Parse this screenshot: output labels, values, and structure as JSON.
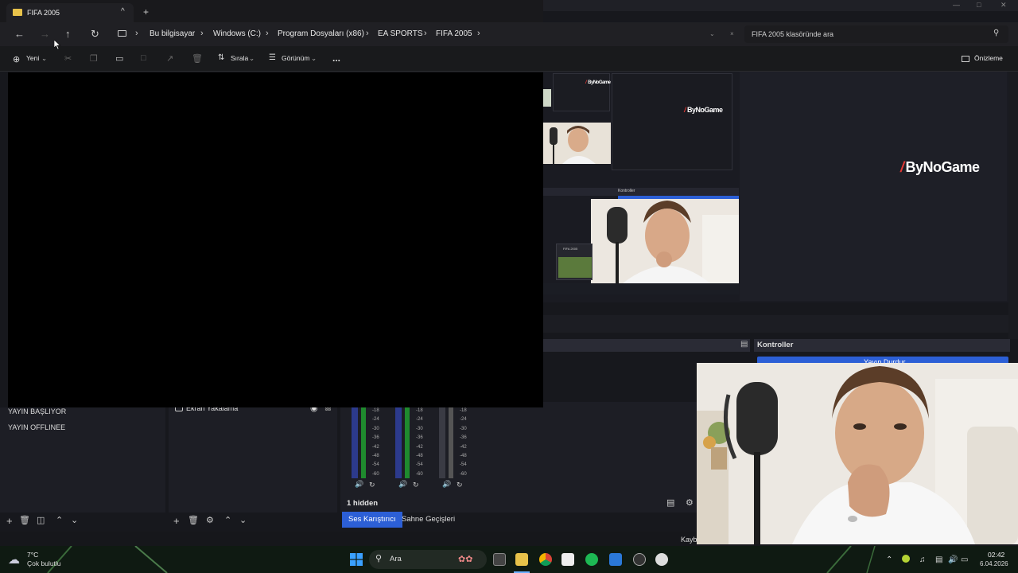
{
  "explorer": {
    "tab_title": "FIFA 2005",
    "breadcrumb": [
      "Bu bilgisayar",
      "Windows (C:)",
      "Program Dosyaları (x86)",
      "EA SPORTS",
      "FIFA 2005"
    ],
    "search_placeholder": "FIFA 2005 klasöründe ara",
    "commands": {
      "new_label": "Yeni",
      "sort_label": "Sırala",
      "view_label": "Görünüm",
      "more_label": "...",
      "preview_label": "Önizleme"
    }
  },
  "obs": {
    "brand_text": "ByNoGame",
    "controls_title": "Kontroller",
    "controls_button": "Yayın Durdur",
    "nested_controls_title": "Kontroller",
    "nested_window_title": "FIFA 2005",
    "scenes": [
      "YAYIN BAŞLIYOR",
      "YAYIN OFFLINEE"
    ],
    "source_item": "Ekran Yakalama",
    "mixer_hidden": "1 hidden",
    "tabs": {
      "audio_mixer": "Ses Karıştırıcı",
      "scene_transitions": "Sahne Geçişleri"
    },
    "db_scale": [
      "-18",
      "-24",
      "-30",
      "-36",
      "-42",
      "-48",
      "-54",
      "-60"
    ],
    "status_partial": "Kayb"
  },
  "taskbar": {
    "weather_temp": "7°C",
    "weather_desc": "Çok bulutlu",
    "search_label": "Ara",
    "time": "02:42",
    "date": "6.04.2026"
  },
  "colors": {
    "accent_blue": "#2c5fd6",
    "brand_red": "#e53935",
    "meter_green": "#1f8a2e",
    "meter_blue": "#2c3a8c"
  }
}
